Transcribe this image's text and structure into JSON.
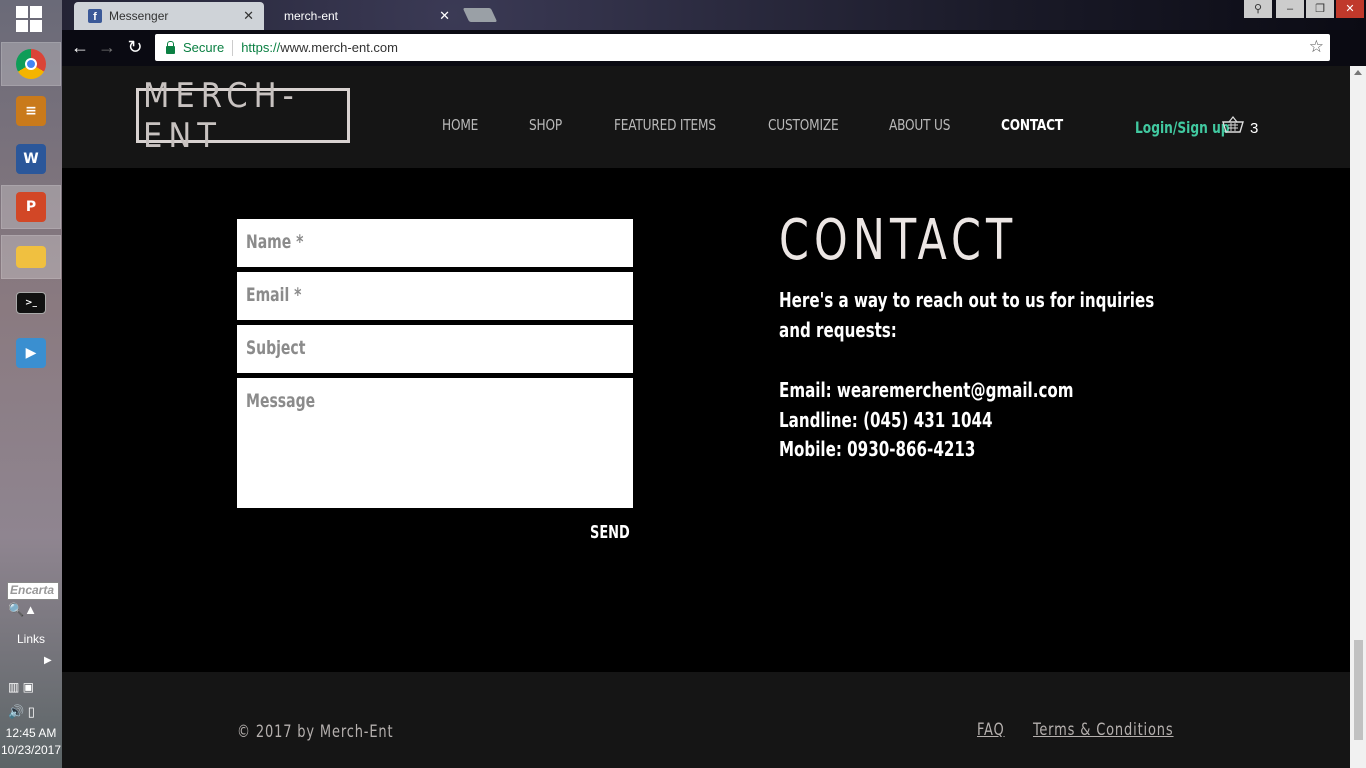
{
  "taskbar": {
    "apps": [
      {
        "name": "chrome",
        "icon": "chrome-icon"
      },
      {
        "name": "winrar",
        "icon": "archive-icon"
      },
      {
        "name": "word",
        "icon": "word-icon",
        "letter": "W"
      },
      {
        "name": "powerpoint",
        "icon": "powerpoint-icon",
        "letter": "P"
      },
      {
        "name": "file-explorer",
        "icon": "folder-icon"
      },
      {
        "name": "command-prompt",
        "icon": "terminal-icon"
      },
      {
        "name": "media-player",
        "icon": "play-icon"
      }
    ],
    "search_placeholder": "Encarta",
    "links_label": "Links",
    "clock_time": "12:45 AM",
    "clock_date": "10/23/2017"
  },
  "browser": {
    "tabs": [
      {
        "label": "Messenger",
        "icon": "facebook-icon"
      },
      {
        "label": "merch-ent",
        "active": true
      }
    ],
    "security_label": "Secure",
    "url_scheme": "https://",
    "url_rest": "www.merch-ent.com"
  },
  "header": {
    "logo": "MERCH-ENT",
    "nav": [
      "HOME",
      "SHOP",
      "FEATURED ITEMS",
      "CUSTOMIZE",
      "ABOUT US",
      "CONTACT"
    ],
    "active_nav": "CONTACT",
    "login_label": "Login/Sign up",
    "cart_count": "3"
  },
  "form": {
    "name_placeholder": "Name *",
    "email_placeholder": "Email *",
    "subject_placeholder": "Subject",
    "message_placeholder": "Message",
    "send_label": "SEND"
  },
  "contact": {
    "title": "CONTACT",
    "intro_line1": "Here's a way to reach out to us for inquiries",
    "intro_line2": "and requests:",
    "email": "Email: wearemerchent@gmail.com",
    "landline": "Landline: (045) 431 1044",
    "mobile": "Mobile: 0930-866-4213"
  },
  "footer": {
    "copyright": "© 2017 by Merch-Ent",
    "faq": "FAQ",
    "terms": "Terms & Conditions"
  },
  "colors": {
    "accent_login": "#41c9a0",
    "page_bg": "#000000",
    "header_bg": "#151515"
  }
}
